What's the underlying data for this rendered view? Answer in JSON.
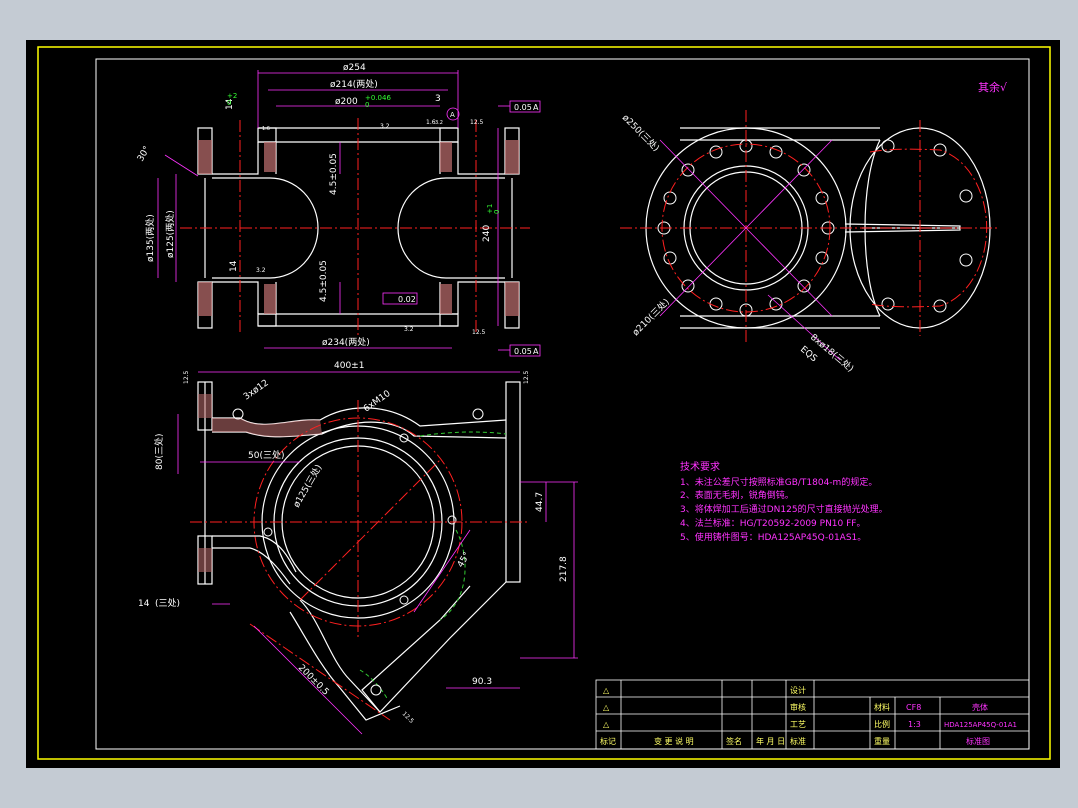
{
  "colors": {
    "background": "#c4cbd3",
    "paper": "#000000",
    "border": "#ffff00",
    "inner_frame": "#ffffff",
    "dimension": "#ff33ff",
    "centerline": "#ff2020",
    "outline": "#ffffff",
    "tolerance": "#33ff33",
    "hidden": "#33cc33"
  },
  "roughness_mark": "其余√",
  "top_view": {
    "dim_254": "ø254",
    "dim_214": "ø214(两处)",
    "dim_200": "ø200",
    "dim_200_tol": "+0.046",
    "dim_200_tol2": "0",
    "dim_3": "3",
    "dim_32": "3.2",
    "dim_16": "1.6",
    "datum_a": "A",
    "flat_top": "0.05",
    "flat_top_ref": "A",
    "dim_125a": "12.5",
    "dim_14a": "14",
    "dim_14_tol": "+2",
    "dim_14_tol2": "0",
    "dim_30deg": "30°",
    "dim_45a": "4.5±0.05",
    "dim_135": "ø135(两处)",
    "dim_125": "ø125(两处)",
    "dim_240": "240",
    "dim_240_tol": "+1",
    "dim_240_tol2": "0",
    "dim_14b": "14",
    "dim_32b": "3.2",
    "dim_45b": "4.5±0.05",
    "flat_mid": "0.02",
    "dim_32c": "3.2",
    "dim_234": "ø234(两处)",
    "dim_125b": "12.5",
    "flat_bot": "0.05",
    "flat_bot_ref": "A",
    "dim_16b": "1.6",
    "dim_32d": "3.2"
  },
  "side_view": {
    "dim_250": "ø250(三处)",
    "dim_210": "ø210(三处)",
    "dim_holes": "8xø18(三处)",
    "dim_eqs": "EQS"
  },
  "front_view": {
    "dim_400": "400±1",
    "dim_125c": "12.5",
    "dim_125d": "12.5",
    "dim_3xm12": "3xø12",
    "dim_6m10": "6xM10",
    "dim_80": "80(三处)",
    "dim_50": "50(三处)",
    "dim_125_circle": "ø125(三处)",
    "dim_447": "44.7",
    "dim_2178": "217.8",
    "dim_45deg": "45°",
    "dim_14c": "14",
    "dim_14c_tol": "(三处)",
    "dim_2000": "200±0.5",
    "dim_903": "90.3",
    "dim_125e": "12.5"
  },
  "notes": {
    "title": "技术要求",
    "lines": [
      "1、未注公差尺寸按照标准GB/T1804-m的规定。",
      "2、表面无毛刺，锐角倒钝。",
      "3、将体焊加工后通过DN125的尺寸直接抛光处理。",
      "4、法兰标准：HG/T20592-2009 PN10 FF。",
      "5、使用铸件图号：HDA125AP45Q-01AS1。"
    ]
  },
  "title_block": {
    "rev_marks": [
      "△",
      "△",
      "△"
    ],
    "footer": [
      "标记",
      "变 更 说 明",
      "签名",
      "年 月 日",
      "标准"
    ],
    "roles": [
      "设计",
      "审核",
      "工艺"
    ],
    "label_material": "材料",
    "material": "CF8",
    "part_name": "壳体",
    "label_scale": "比例",
    "scale": "1:3",
    "drawing_no": "HDA125AP45Q-01A1",
    "label_weight": "重量",
    "standard": "标准图"
  }
}
